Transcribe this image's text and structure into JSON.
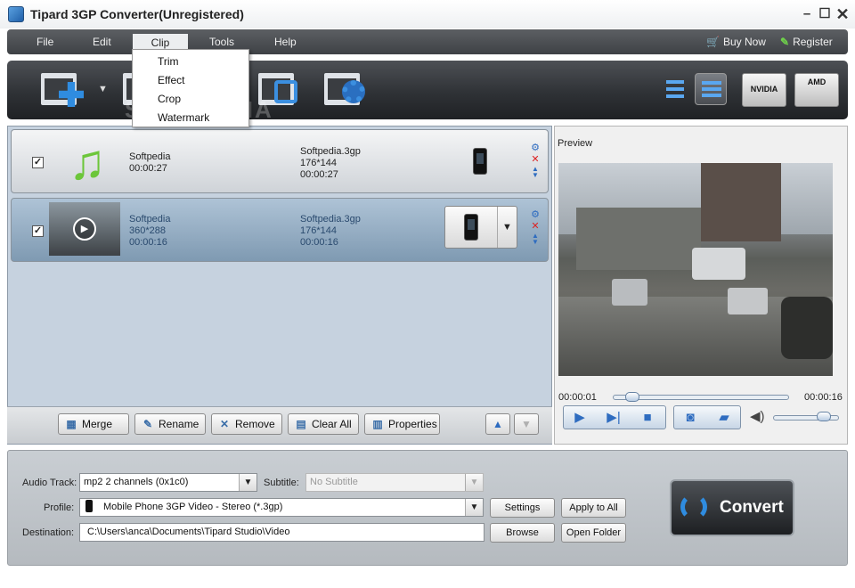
{
  "window": {
    "title": "Tipard 3GP Converter(Unregistered)"
  },
  "menu": {
    "items": [
      "File",
      "Edit",
      "Clip",
      "Tools",
      "Help"
    ],
    "buy_now": "Buy Now",
    "register": "Register"
  },
  "clip_menu": {
    "items": [
      "Trim",
      "Effect",
      "Crop",
      "Watermark"
    ]
  },
  "toolbar": {
    "icons": [
      "add-video-icon",
      "clip-icon",
      "crop-icon",
      "merge-clip-icon",
      "effect-settings-icon"
    ],
    "badges": [
      "NVIDIA",
      "AMD"
    ]
  },
  "watermark_text": "SOFTPEDIA",
  "files": [
    {
      "name": "Softpedia",
      "duration": "00:00:27",
      "resolution": "",
      "out_name": "Softpedia.3gp",
      "out_res": "176*144",
      "out_duration": "00:00:27",
      "checked": true
    },
    {
      "name": "Softpedia",
      "resolution": "360*288",
      "duration": "00:00:16",
      "out_name": "Softpedia.3gp",
      "out_res": "176*144",
      "out_duration": "00:00:16",
      "checked": true
    }
  ],
  "list_buttons": {
    "merge": "Merge",
    "rename": "Rename",
    "remove": "Remove",
    "clear_all": "Clear All",
    "properties": "Properties"
  },
  "preview": {
    "label": "Preview",
    "current_time": "00:00:01",
    "total_time": "00:00:16",
    "progress": 0.06,
    "volume": 0.85
  },
  "settings": {
    "audio_track_label": "Audio Track:",
    "audio_track_value": "mp2 2 channels (0x1c0)",
    "subtitle_label": "Subtitle:",
    "subtitle_value": "No Subtitle",
    "profile_label": "Profile:",
    "profile_value": "Mobile Phone 3GP Video - Stereo (*.3gp)",
    "destination_label": "Destination:",
    "destination_value": "C:\\Users\\anca\\Documents\\Tipard Studio\\Video",
    "settings_button": "Settings",
    "apply_all_button": "Apply to All",
    "browse_button": "Browse",
    "open_folder_button": "Open Folder"
  },
  "convert_button": "Convert"
}
